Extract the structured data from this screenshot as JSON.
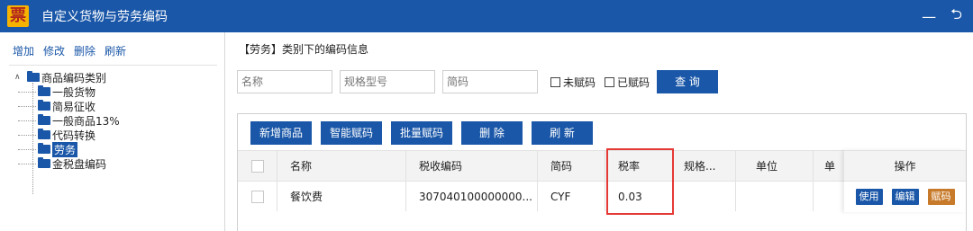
{
  "window": {
    "logo_text": "票",
    "title": "自定义货物与劳务编码",
    "minimize_glyph": "—",
    "restore_glyph": "⮌"
  },
  "left": {
    "toolbar": [
      "增加",
      "修改",
      "删除",
      "刷新"
    ],
    "tree": {
      "root_expander": "∧",
      "root": "商品编码类别",
      "children": [
        "一般货物",
        "简易征收",
        "一般商品13%",
        "代码转换",
        "劳务",
        "金税盘编码"
      ],
      "selected": "劳务"
    }
  },
  "right": {
    "section_title": "【劳务】类别下的编码信息",
    "search": {
      "name_placeholder": "名称",
      "spec_placeholder": "规格型号",
      "short_placeholder": "简码",
      "unassigned_label": "未赋码",
      "assigned_label": "已赋码",
      "query_button": "查 询"
    },
    "grid_toolbar": [
      "新增商品",
      "智能赋码",
      "批量赋码",
      "删 除",
      "刷 新"
    ],
    "table": {
      "columns": [
        "名称",
        "税收编码",
        "简码",
        "税率",
        "规格...",
        "单位",
        "单"
      ],
      "ops_header": "操作",
      "rows": [
        {
          "name": "餐饮费",
          "tax_code": "307040100000000...",
          "short": "CYF",
          "rate": "0.03",
          "spec": "",
          "unit": "",
          "extra": ""
        }
      ],
      "row_actions": [
        "使用",
        "编辑",
        "赋码"
      ]
    }
  },
  "colors": {
    "accent": "#1a57a8",
    "orange": "#c77a2a",
    "highlight": "#e53935"
  }
}
